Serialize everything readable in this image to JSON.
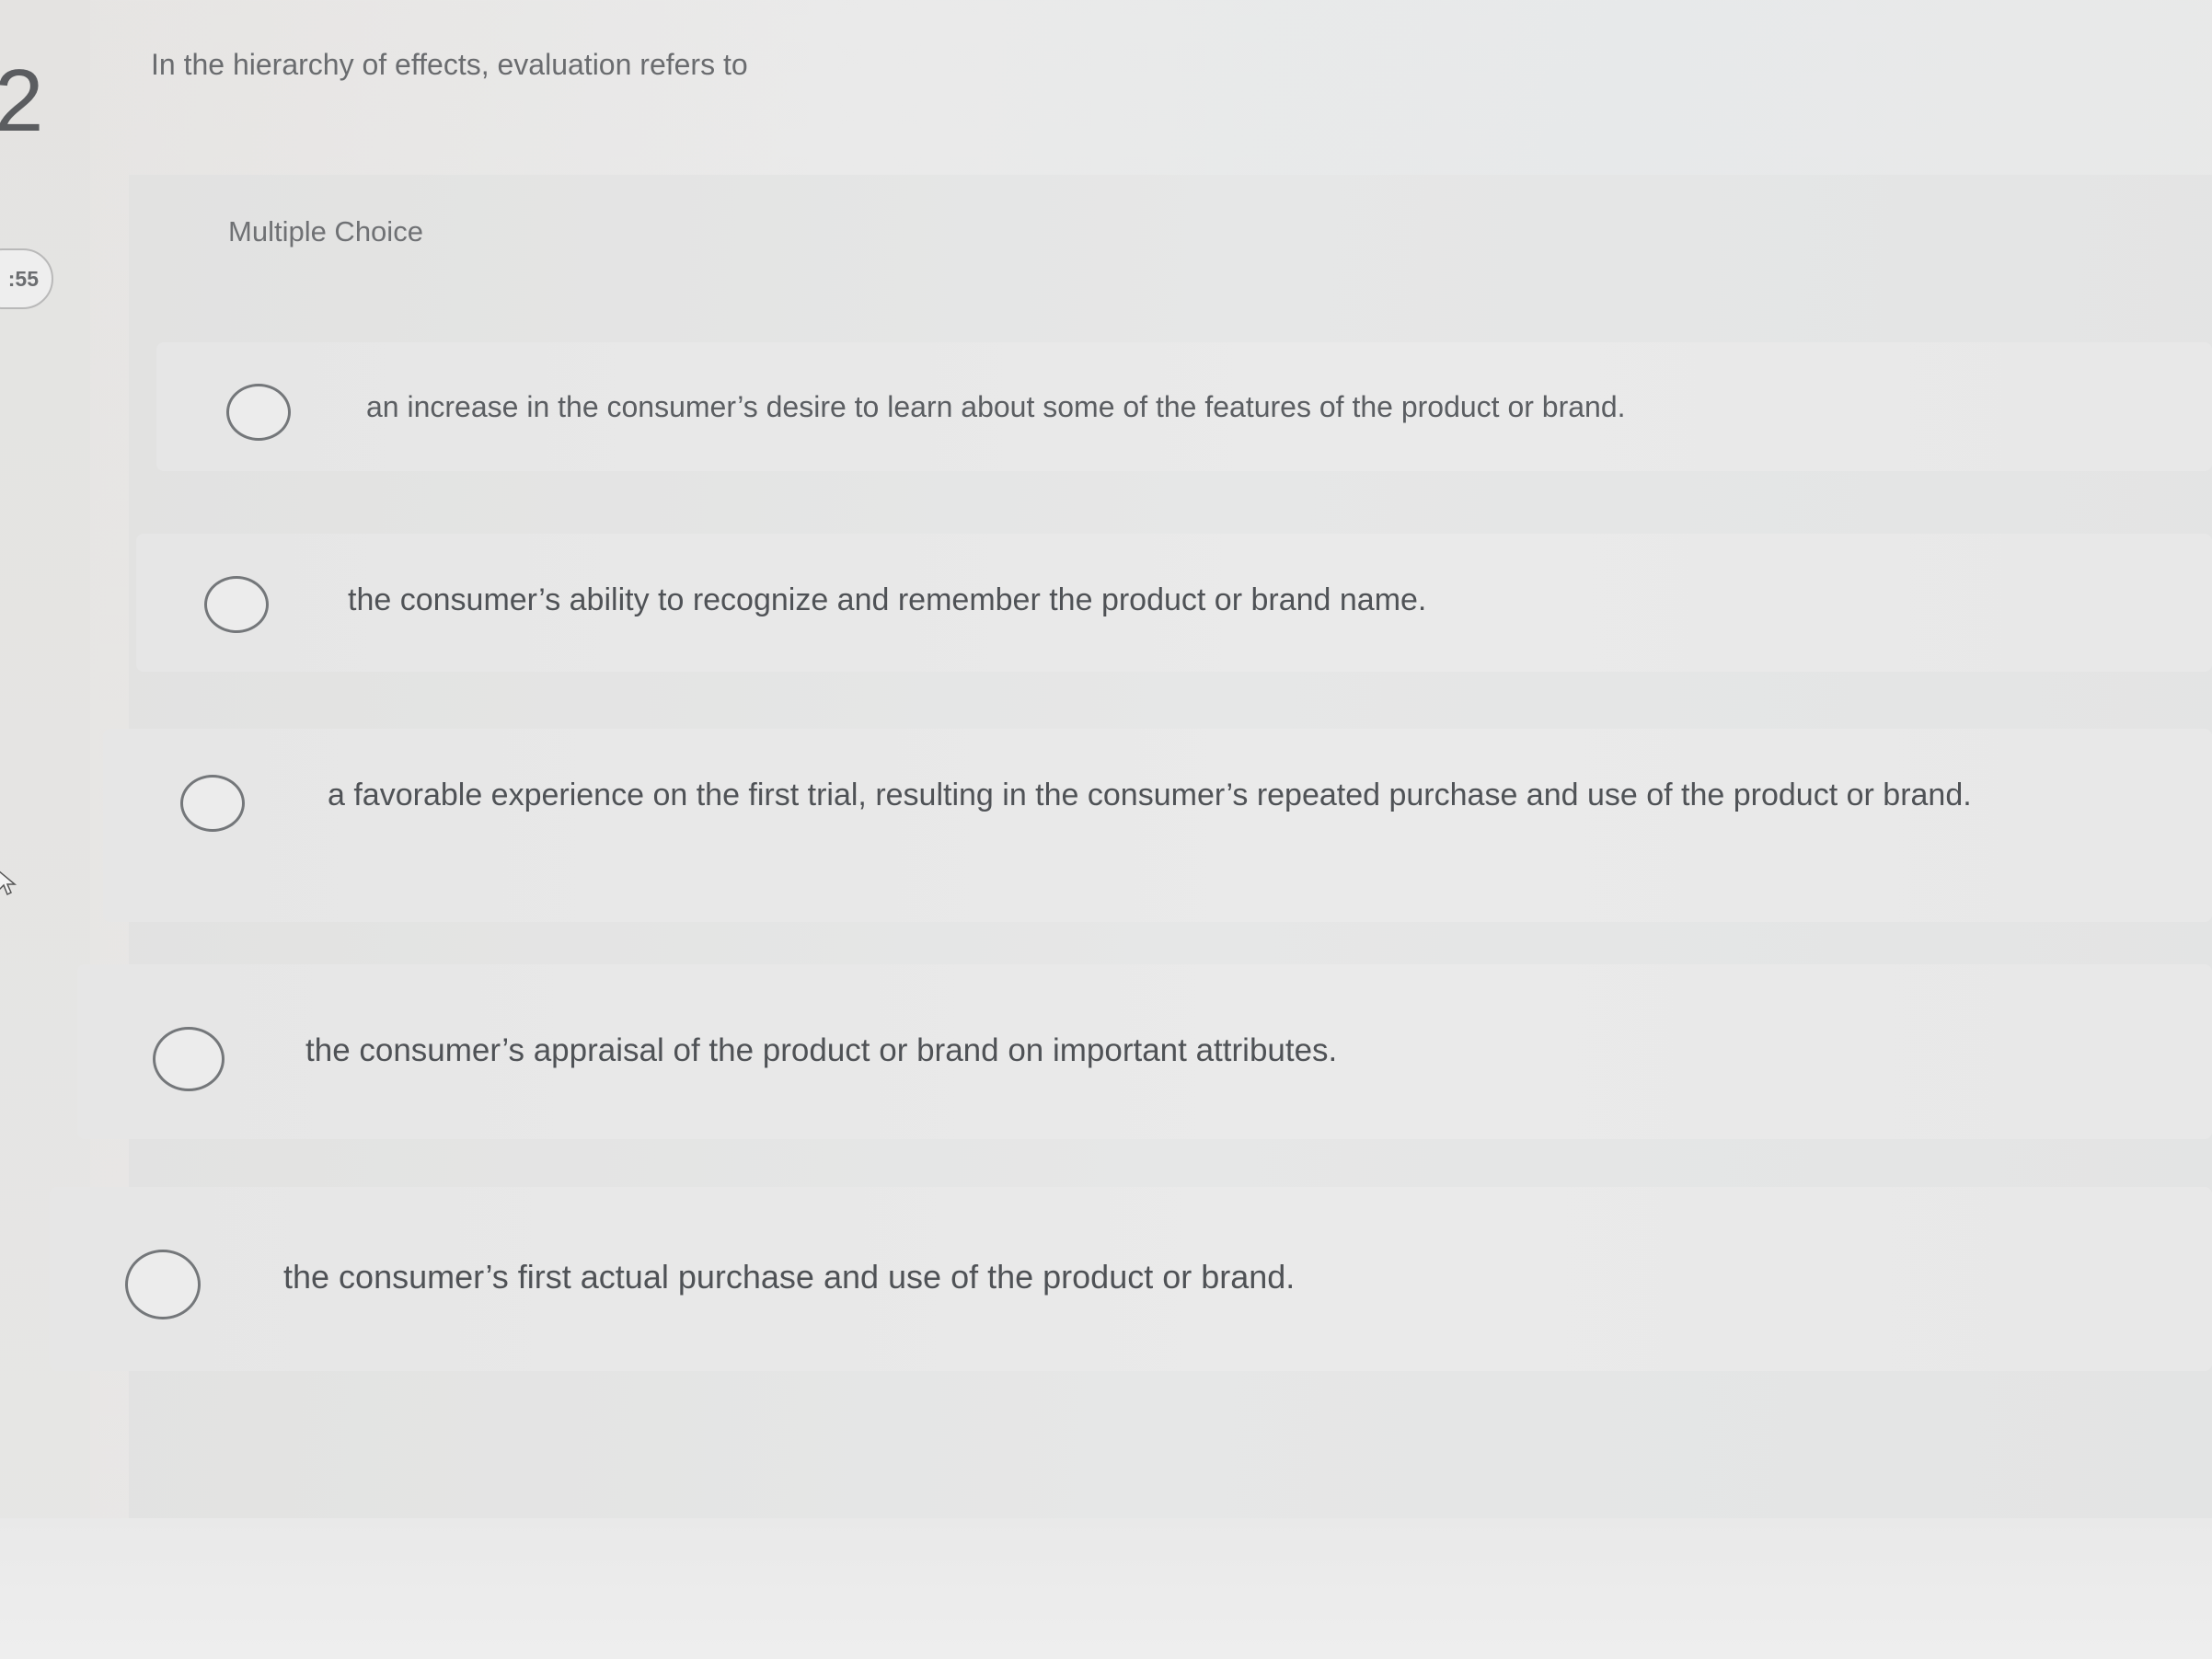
{
  "question": {
    "number": "2",
    "timer": ":55",
    "prompt": "In the hierarchy of effects, evaluation refers to",
    "type_label": "Multiple Choice"
  },
  "options": [
    {
      "label": "an increase in the consumer’s desire to learn about some of the features of the product or brand."
    },
    {
      "label": "the consumer’s ability to recognize and remember the product or brand name."
    },
    {
      "label": "a favorable experience on the first trial, resulting in the consumer’s repeated purchase and use of the product or brand."
    },
    {
      "label": "the consumer’s appraisal of the product or brand on important attributes."
    },
    {
      "label": "the consumer’s first actual purchase and use of the product or brand."
    }
  ],
  "icons": {
    "cursor": "mouse-pointer-icon",
    "radio": "radio-button-unselected"
  }
}
